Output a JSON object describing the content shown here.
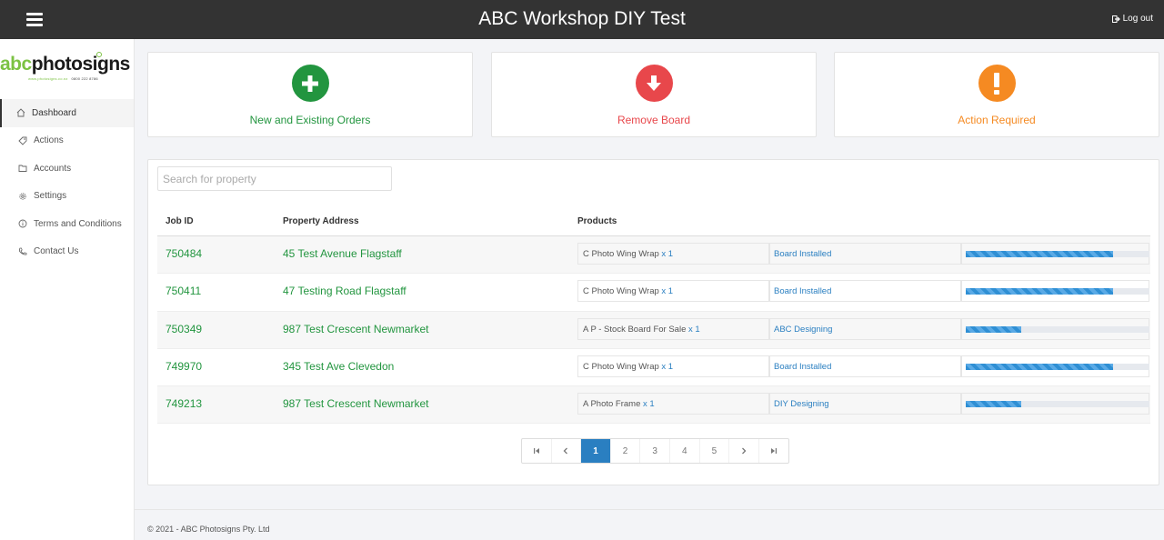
{
  "header": {
    "title": "ABC Workshop DIY Test",
    "logout_label": "Log out"
  },
  "logo": {
    "brand_part1": "abc",
    "brand_part2": "photosigns",
    "url": "www.photosigns.co.nz",
    "phone": "0800 222 8786"
  },
  "sidebar": {
    "items": [
      {
        "label": "Dashboard",
        "icon": "home-icon"
      },
      {
        "label": "Actions",
        "icon": "tag-icon"
      },
      {
        "label": "Accounts",
        "icon": "folder-icon"
      },
      {
        "label": "Settings",
        "icon": "gear-icon"
      },
      {
        "label": "Terms and Conditions",
        "icon": "info-icon"
      },
      {
        "label": "Contact Us",
        "icon": "phone-icon"
      }
    ]
  },
  "cards": [
    {
      "label": "New and Existing Orders",
      "icon": "plus-icon",
      "color": "#22953f"
    },
    {
      "label": "Remove Board",
      "icon": "arrow-down-icon",
      "color": "#e8474b"
    },
    {
      "label": "Action Required",
      "icon": "exclamation-icon",
      "color": "#f58a22"
    }
  ],
  "search": {
    "placeholder": "Search for property",
    "value": ""
  },
  "table": {
    "headers": {
      "job_id": "Job ID",
      "address": "Property Address",
      "products": "Products"
    },
    "rows": [
      {
        "job_id": "750484",
        "address": "45 Test Avenue Flagstaff",
        "product": "C Photo Wing Wrap",
        "qty": "x 1",
        "status": "Board Installed",
        "progress": 0.8
      },
      {
        "job_id": "750411",
        "address": "47 Testing Road Flagstaff",
        "product": "C Photo Wing Wrap",
        "qty": "x 1",
        "status": "Board Installed",
        "progress": 0.8
      },
      {
        "job_id": "750349",
        "address": "987 Test Crescent Newmarket",
        "product": "A P - Stock Board For Sale",
        "qty": "x 1",
        "status": "ABC Designing",
        "progress": 0.3
      },
      {
        "job_id": "749970",
        "address": "345 Test Ave Clevedon",
        "product": "C Photo Wing Wrap",
        "qty": "x 1",
        "status": "Board Installed",
        "progress": 0.8
      },
      {
        "job_id": "749213",
        "address": "987 Test Crescent Newmarket",
        "product": "A Photo Frame",
        "qty": "x 1",
        "status": "DIY Designing",
        "progress": 0.3
      }
    ]
  },
  "pagination": {
    "pages": [
      "1",
      "2",
      "3",
      "4",
      "5"
    ],
    "current": "1"
  },
  "footer": {
    "text": "© 2021 - ABC Photosigns Pty. Ltd"
  }
}
